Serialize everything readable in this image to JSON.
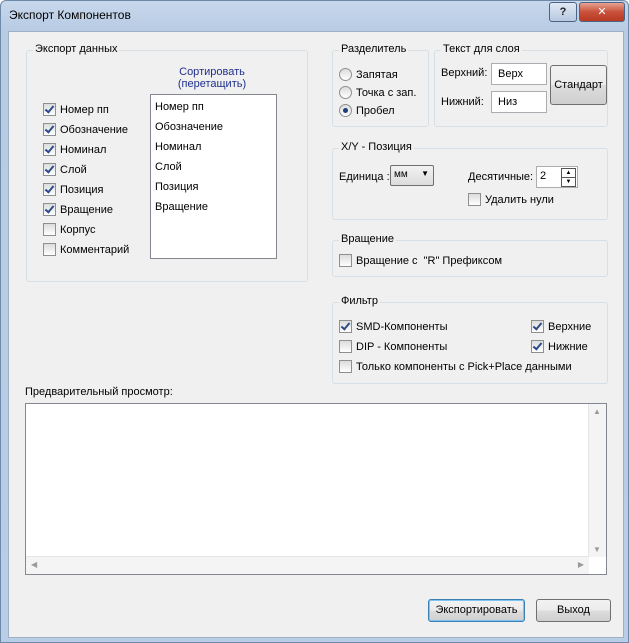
{
  "window": {
    "title": "Экспорт Компонентов",
    "help": "?",
    "close": "✕"
  },
  "export_data": {
    "label": "Экспорт данных",
    "sort_title_line1": "Сортировать",
    "sort_title_line2": "(перетащить)",
    "fields": [
      {
        "label": "Номер пп",
        "checked": true
      },
      {
        "label": "Обозначение",
        "checked": true
      },
      {
        "label": "Номинал",
        "checked": true
      },
      {
        "label": "Слой",
        "checked": true
      },
      {
        "label": "Позиция",
        "checked": true
      },
      {
        "label": "Вращение",
        "checked": true
      },
      {
        "label": "Корпус",
        "checked": false
      },
      {
        "label": "Комментарий",
        "checked": false
      }
    ],
    "sort_list": [
      "Номер пп",
      "Обозначение",
      "Номинал",
      "Слой",
      "Позиция",
      "Вращение"
    ]
  },
  "separator": {
    "label": "Разделитель",
    "options": [
      {
        "label": "Запятая",
        "selected": false
      },
      {
        "label": "Точка с зап.",
        "selected": false
      },
      {
        "label": "Пробел",
        "selected": true
      }
    ]
  },
  "layer_text": {
    "label": "Текст для слоя",
    "top_label": "Верхний:",
    "top_value": "Верх",
    "bottom_label": "Нижний:",
    "bottom_value": "Низ",
    "default_button": "Стандарт"
  },
  "xy": {
    "label": "X/Y - Позиция",
    "unit_label": "Единица :",
    "unit_value": "мм",
    "decimals_label": "Десятичные:",
    "decimals_value": "2",
    "remove_zeros_label": "Удалить нули",
    "remove_zeros_checked": false
  },
  "rotation": {
    "label": "Вращение",
    "prefix_label": "Вращение с  \"R\" Префиксом",
    "prefix_checked": false
  },
  "filter": {
    "label": "Фильтр",
    "smd_label": "SMD-Компоненты",
    "smd_checked": true,
    "dip_label": "DIP - Компоненты",
    "dip_checked": false,
    "pickplace_label": "Только компоненты с Pick+Place данными",
    "pickplace_checked": false,
    "top_label": "Верхние",
    "top_checked": true,
    "bottom_label": "Нижние",
    "bottom_checked": true
  },
  "preview": {
    "label": "Предварительный просмотр:",
    "content": ""
  },
  "buttons": {
    "export": "Экспортировать",
    "exit": "Выход"
  }
}
